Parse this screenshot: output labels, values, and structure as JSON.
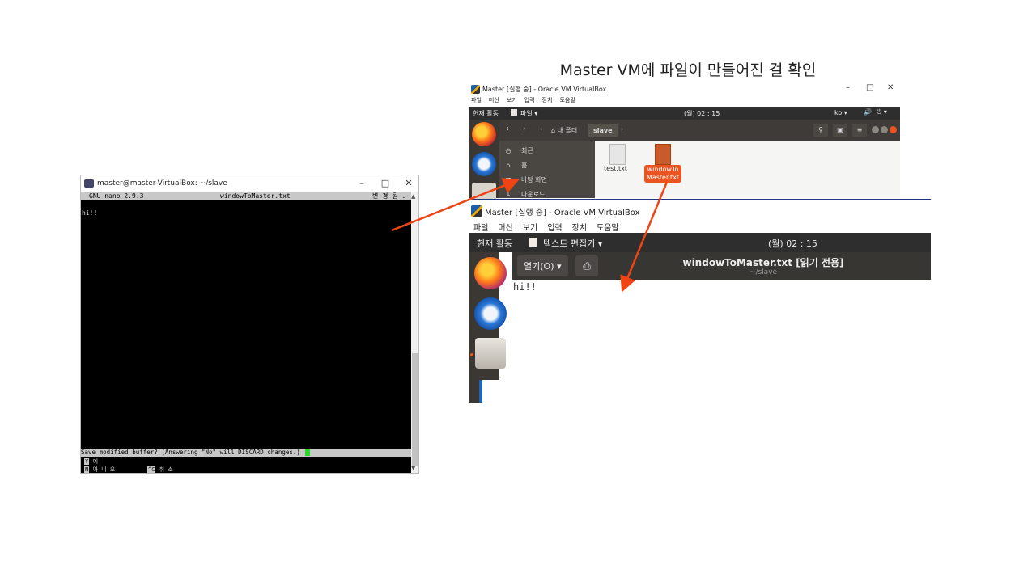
{
  "caption": "Master VM에 파일이 만들어진 걸 확인",
  "terminal": {
    "title": "master@master-VirtualBox: ~/slave",
    "nano_version": "GNU nano 2.9.3",
    "filename": "windowToMaster.txt",
    "status": "변 경 됨 .",
    "content": "hi!!",
    "prompt": "Save modified buffer?  (Answering \"No\" will DISCARD changes.)",
    "opt_yes_key": "Y",
    "opt_yes_label": "예",
    "opt_no_key": "N",
    "opt_no_label": "아 니 오",
    "opt_cancel_key": "^C",
    "opt_cancel_label": "취 소"
  },
  "vb_files": {
    "title": "Master [실행 중] - Oracle VM VirtualBox",
    "menu": [
      "파일",
      "머신",
      "보기",
      "입력",
      "장치",
      "도움말"
    ],
    "activities": "현재 활동",
    "app_menu": "파일 ▾",
    "clock": "(월) 02 : 15",
    "lang": "ko ▾",
    "crumb_home": "내 폴더",
    "crumb_current": "slave",
    "sidebar": [
      "최근",
      "홈",
      "바탕 화면",
      "다운로드"
    ],
    "file1": "test.txt",
    "file2_line1": "windowTo",
    "file2_line2": "Master.txt"
  },
  "vb_gedit": {
    "title": "Master [실행 중] - Oracle VM VirtualBox",
    "menu": [
      "파일",
      "머신",
      "보기",
      "입력",
      "장치",
      "도움말"
    ],
    "activities": "현재 활동",
    "app_menu": "텍스트 편집기 ▾",
    "clock": "(월) 02 : 15",
    "open_button": "열기(O) ▾",
    "doc_title": "windowToMaster.txt [읽기 전용]",
    "doc_path": "~/slave",
    "content": "hi!!"
  }
}
